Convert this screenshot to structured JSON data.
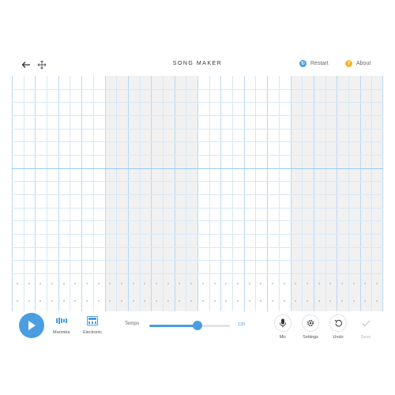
{
  "header": {
    "title": "SONG MAKER",
    "restart_label": "Restart",
    "about_label": "About"
  },
  "icons": {
    "back": "arrow-left-icon",
    "move": "move-arrows-icon",
    "restart": "restart-icon",
    "about": "info-icon",
    "play": "play-icon",
    "marimba": "marimba-icon",
    "electronic": "electronic-icon",
    "mic": "microphone-icon",
    "settings": "gear-icon",
    "undo": "undo-icon",
    "save": "checkmark-icon"
  },
  "colors": {
    "accent": "#4a9de0",
    "about_dot": "#f2b52a",
    "shade": "#f1f1f1",
    "grid_line": "#d6e8f7"
  },
  "grid": {
    "columns": 32,
    "rows": 15,
    "measures": 4,
    "shaded_measures": [
      1,
      3
    ]
  },
  "toolbar": {
    "instrument_1_label": "Marimba",
    "instrument_2_label": "Electronic",
    "tempo_label": "Tempo",
    "tempo_value": "120",
    "tempo_fraction": 0.6,
    "mic_label": "Mic",
    "settings_label": "Settings",
    "undo_label": "Undo",
    "save_label": "Save"
  }
}
